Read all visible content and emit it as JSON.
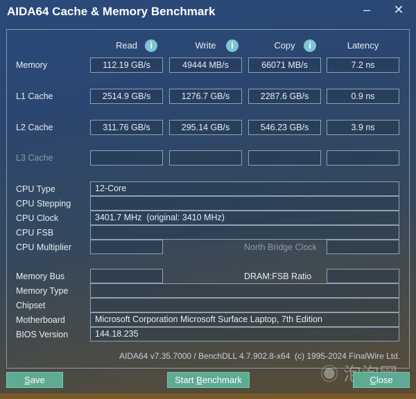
{
  "title": "AIDA64 Cache & Memory Benchmark",
  "window": {
    "minimize_icon": "minimize-icon",
    "close_icon": "close-icon"
  },
  "columns": [
    "Read",
    "Write",
    "Copy",
    "Latency"
  ],
  "rows": [
    {
      "label": "Memory",
      "values": [
        "112.19 GB/s",
        "49444 MB/s",
        "66071 MB/s",
        "7.2 ns"
      ]
    },
    {
      "label": "L1 Cache",
      "values": [
        "2514.9 GB/s",
        "1276.7 GB/s",
        "2287.6 GB/s",
        "0.9 ns"
      ]
    },
    {
      "label": "L2 Cache",
      "values": [
        "311.76 GB/s",
        "295.14 GB/s",
        "546.23 GB/s",
        "3.9 ns"
      ]
    },
    {
      "label": "L3 Cache",
      "values": [
        "",
        "",
        "",
        ""
      ]
    }
  ],
  "cpu": {
    "type_label": "CPU Type",
    "type": "12-Core",
    "stepping_label": "CPU Stepping",
    "stepping": "",
    "clock_label": "CPU Clock",
    "clock": "3401.7 MHz  (original: 3410 MHz)",
    "fsb_label": "CPU FSB",
    "fsb": "",
    "multiplier_label": "CPU Multiplier",
    "multiplier": "",
    "nb_clock_label": "North Bridge Clock",
    "nb_clock": ""
  },
  "memory": {
    "bus_label": "Memory Bus",
    "bus": "",
    "ratio_label": "DRAM:FSB Ratio",
    "ratio": "",
    "type_label": "Memory Type",
    "type": "",
    "chipset_label": "Chipset",
    "chipset": "",
    "motherboard_label": "Motherboard",
    "motherboard": "Microsoft Corporation Microsoft Surface Laptop, 7th Edition",
    "bios_label": "BIOS Version",
    "bios": "144.18.235"
  },
  "footer": "AIDA64 v7.35.7000 / BenchDLL 4.7.902.8-x64  (c) 1995-2024 FinalWire Ltd.",
  "buttons": {
    "save_u": "S",
    "save": "ave",
    "start_a": "Start ",
    "start_u": "B",
    "start_b": "enchmark",
    "close_u": "C",
    "close": "lose"
  },
  "watermark": "泡泡网"
}
